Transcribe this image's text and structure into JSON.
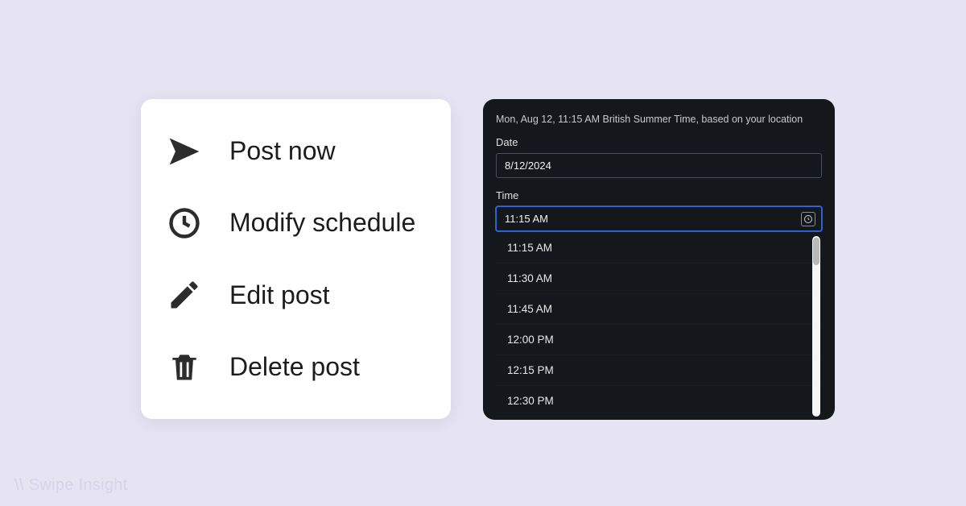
{
  "menu": {
    "items": [
      {
        "label": "Post now"
      },
      {
        "label": "Modify schedule"
      },
      {
        "label": "Edit post"
      },
      {
        "label": "Delete post"
      }
    ]
  },
  "datetime": {
    "timezone_note": "Mon, Aug 12, 11:15 AM British Summer Time, based on your location",
    "date_label": "Date",
    "date_value": "8/12/2024",
    "time_label": "Time",
    "time_value": "11:15 AM",
    "time_options": [
      "11:15 AM",
      "11:30 AM",
      "11:45 AM",
      "12:00 PM",
      "12:15 PM",
      "12:30 PM"
    ]
  },
  "watermark": {
    "text": "Swipe Insight"
  }
}
